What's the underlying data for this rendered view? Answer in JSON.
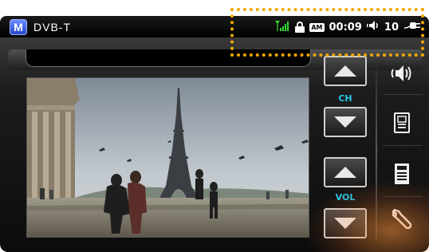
{
  "app": {
    "logo_letter": "M",
    "title": "DVB-T"
  },
  "status": {
    "signal_icon": "signal-antenna-icon",
    "lock_icon": "lock-icon",
    "am_badge": "AM",
    "time": "00:09",
    "speaker_icon": "speaker-icon",
    "volume": "10",
    "plug_icon": "power-plug-icon"
  },
  "controls": {
    "channel_label": "CH",
    "volume_label": "VOL"
  },
  "side_icons": [
    "audio-icon",
    "epg-icon",
    "teletext-icon",
    "settings-wrench-icon"
  ],
  "colors": {
    "highlight": "#f2a900",
    "label_accent": "#20c8e8",
    "signal": "#35e035"
  }
}
